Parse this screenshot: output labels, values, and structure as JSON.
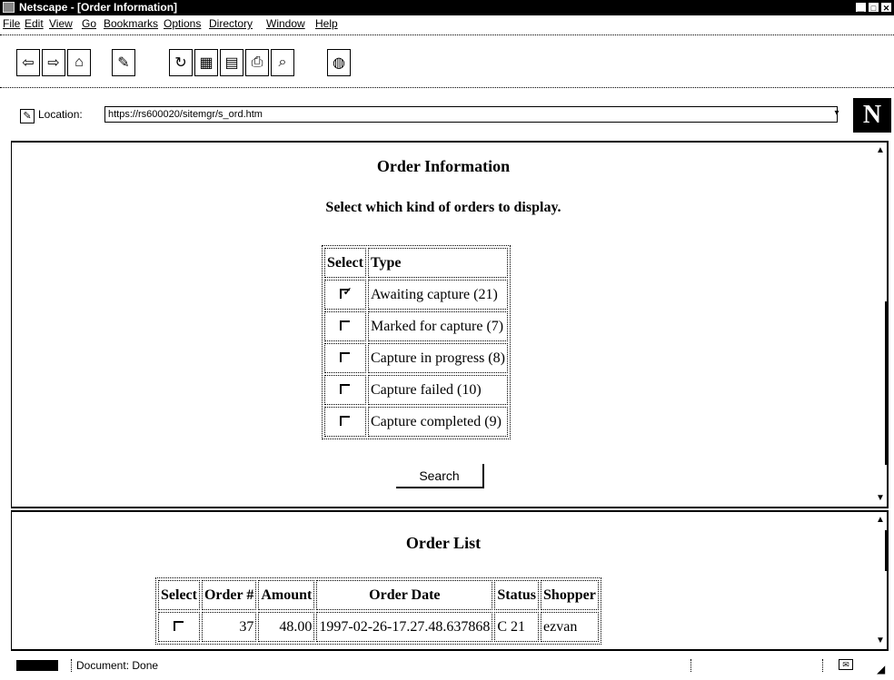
{
  "window": {
    "title": "Netscape - [Order Information]",
    "controls": [
      "minimize-icon",
      "maximize-icon",
      "close-icon"
    ]
  },
  "menu": {
    "items": [
      "File",
      "Edit",
      "View",
      "Go",
      "Bookmarks",
      "Options",
      "Directory",
      "Window",
      "Help"
    ]
  },
  "toolbar": {
    "buttons": [
      "back-icon",
      "forward-icon",
      "home-icon",
      "edit-icon",
      "reload-icon",
      "images-icon",
      "open-icon",
      "print-icon",
      "find-icon",
      "stop-icon"
    ]
  },
  "location": {
    "label": "Location:",
    "url": "https://rs600020/sitemgr/s_ord.htm"
  },
  "orderInfo": {
    "title": "Order Information",
    "subtitle": "Select which kind of orders to display.",
    "headers": [
      "Select",
      "Type"
    ],
    "rows": [
      {
        "checked": true,
        "type": "Awaiting capture (21)"
      },
      {
        "checked": false,
        "type": "Marked for capture (7)"
      },
      {
        "checked": false,
        "type": "Capture in progress (8)"
      },
      {
        "checked": false,
        "type": "Capture failed (10)"
      },
      {
        "checked": false,
        "type": "Capture completed (9)"
      }
    ],
    "searchLabel": "Search"
  },
  "orderList": {
    "title": "Order List",
    "headers": [
      "Select",
      "Order #",
      "Amount",
      "Order Date",
      "Status",
      "Shopper"
    ],
    "rows": [
      {
        "checked": false,
        "order": "37",
        "amount": "48.00",
        "date": "1997-02-26-17.27.48.637868",
        "status": "C 21",
        "shopper": "ezvan"
      }
    ]
  },
  "status": {
    "text": "Document: Done"
  }
}
